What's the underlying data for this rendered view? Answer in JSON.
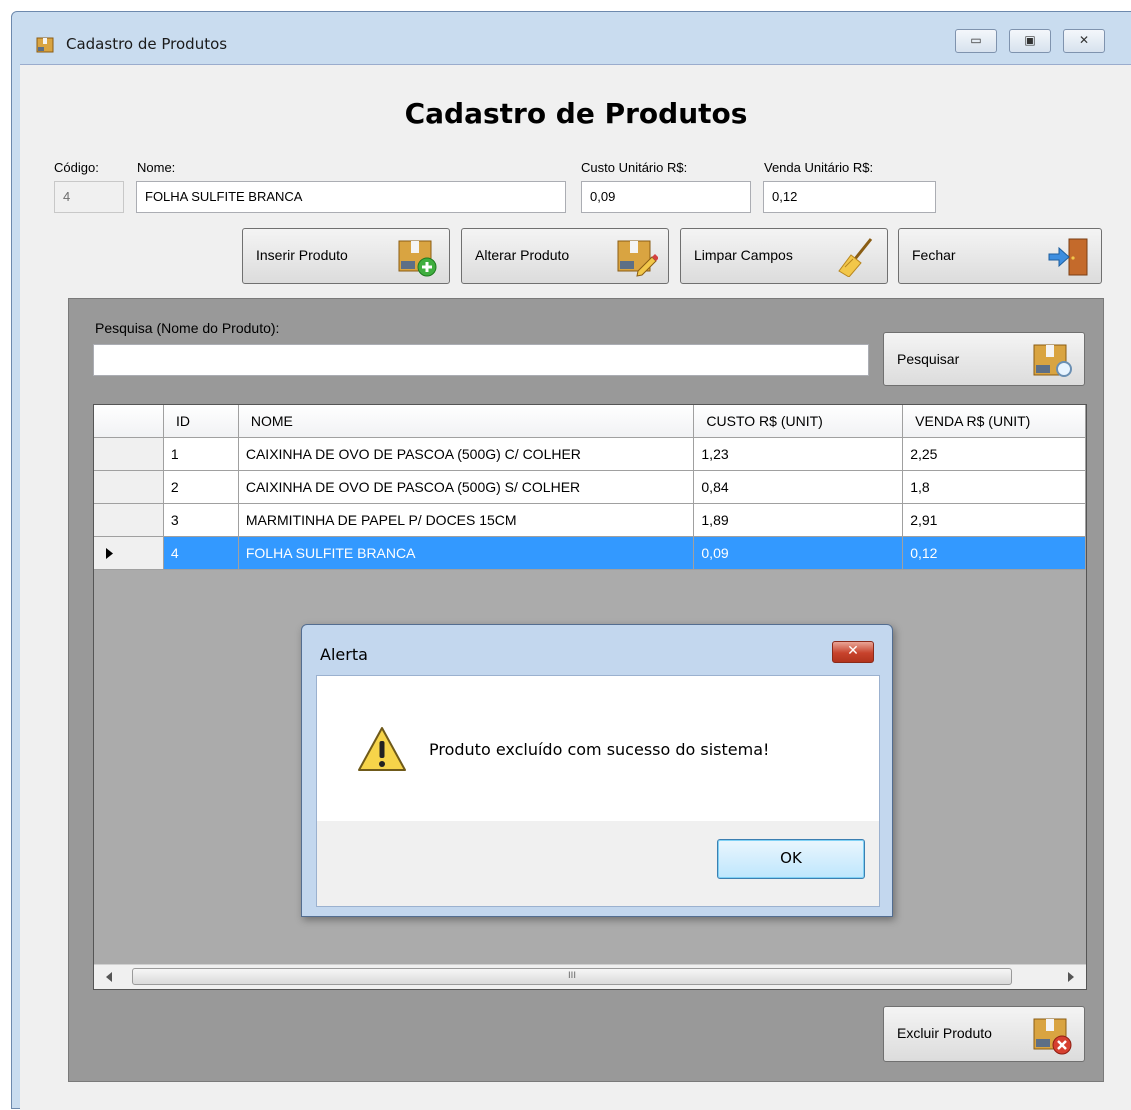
{
  "window": {
    "title": "Cadastro de Produtos",
    "controls": {
      "minimize": "▭",
      "maximize": "▣",
      "close": "✕"
    }
  },
  "form": {
    "heading": "Cadastro de Produtos",
    "fields": {
      "codigo": {
        "label": "Código:",
        "value": "4"
      },
      "nome": {
        "label": "Nome:",
        "value": "FOLHA SULFITE BRANCA"
      },
      "custo": {
        "label": "Custo Unitário R$:",
        "value": "0,09"
      },
      "venda": {
        "label": "Venda Unitário R$:",
        "value": "0,12"
      }
    },
    "buttons": {
      "inserir": "Inserir Produto",
      "alterar": "Alterar Produto",
      "limpar": "Limpar Campos",
      "fechar": "Fechar"
    }
  },
  "search": {
    "label": "Pesquisa (Nome do Produto):",
    "value": "",
    "button": "Pesquisar"
  },
  "grid": {
    "columns": [
      "ID",
      "NOME",
      "CUSTO R$ (UNIT)",
      "VENDA R$ (UNIT)"
    ],
    "rows": [
      [
        "1",
        "CAIXINHA DE OVO DE PASCOA (500G) C/ COLHER",
        "1,23",
        "2,25"
      ],
      [
        "2",
        "CAIXINHA DE OVO DE PASCOA (500G) S/ COLHER",
        "0,84",
        "1,8"
      ],
      [
        "3",
        "MARMITINHA DE PAPEL P/ DOCES 15CM",
        "1,89",
        "2,91"
      ],
      [
        "4",
        "FOLHA SULFITE BRANCA",
        "0,09",
        "0,12"
      ]
    ],
    "selected_row_index": 3,
    "scroll_thumb_glyph": "III"
  },
  "delete_button": "Excluir Produto",
  "dialog": {
    "title": "Alerta",
    "message": "Produto excluído com sucesso do sistema!",
    "ok": "OK",
    "close": "✕"
  },
  "colors": {
    "selection": "#3399ff",
    "panel": "#999999",
    "window_frame": "#c9dcef"
  }
}
